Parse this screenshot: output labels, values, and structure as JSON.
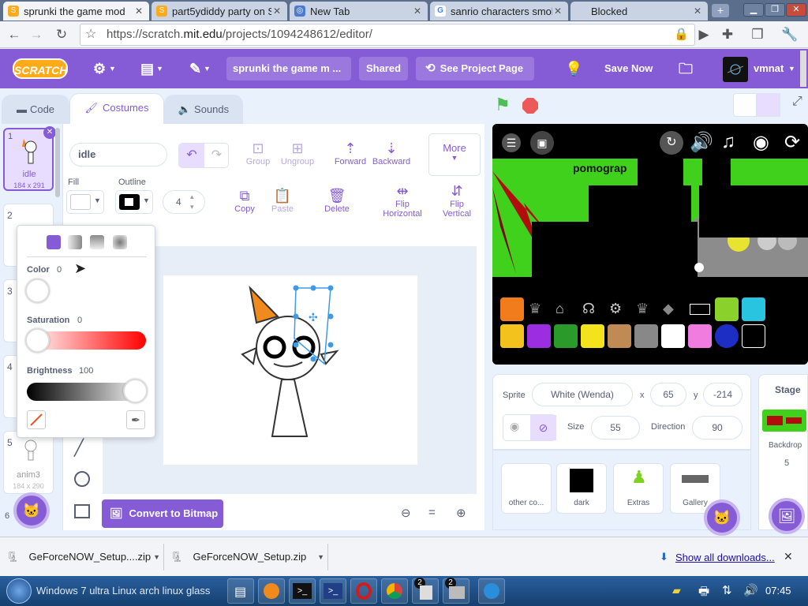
{
  "browser": {
    "tabs": [
      {
        "title": "sprunki the game mod",
        "active": true
      },
      {
        "title": "part5ydiddy party on Sc",
        "active": false
      },
      {
        "title": "New Tab",
        "active": false
      },
      {
        "title": "sanrio characters smol",
        "active": false
      },
      {
        "title": "Blocked",
        "active": false
      }
    ],
    "url_prefix": "https://scratch.",
    "url_domain": "mit.edu",
    "url_path": "/projects/1094248612/editor/"
  },
  "menubar": {
    "logo": "SCRATCH",
    "project_title": "sprunki the game m ...",
    "shared_label": "Shared",
    "see_project_label": "See Project Page",
    "save_now_label": "Save Now",
    "username": "vmnat"
  },
  "editor_tabs": {
    "code": "Code",
    "costumes": "Costumes",
    "sounds": "Sounds"
  },
  "costumes": [
    {
      "num": "1",
      "name": "idle",
      "size": "184 x 291",
      "selected": true
    },
    {
      "num": "2",
      "name": "",
      "size": "",
      "selected": false
    },
    {
      "num": "3",
      "name": "",
      "size": "",
      "selected": false
    },
    {
      "num": "4",
      "name": "",
      "size": "",
      "selected": false
    },
    {
      "num": "5",
      "name": "anim3",
      "size": "184 x 290",
      "selected": false
    },
    {
      "num": "6",
      "name": "",
      "size": "",
      "selected": false
    }
  ],
  "paint": {
    "costume_name": "idle",
    "group": "Group",
    "ungroup": "Ungroup",
    "forward": "Forward",
    "backward": "Backward",
    "more": "More",
    "fill_label": "Fill",
    "outline_label": "Outline",
    "outline_width": "4",
    "copy": "Copy",
    "paste": "Paste",
    "delete": "Delete",
    "flip_h_1": "Flip",
    "flip_h_2": "Horizontal",
    "flip_v_1": "Flip",
    "flip_v_2": "Vertical",
    "convert": "Convert to Bitmap"
  },
  "color_popup": {
    "color_label": "Color",
    "color_value": "0",
    "saturation_label": "Saturation",
    "saturation_value": "0",
    "brightness_label": "Brightness",
    "brightness_value": "100"
  },
  "stage": {
    "overlay_text": "pomograp"
  },
  "sprite_info": {
    "sprite_label": "Sprite",
    "sprite_name": "White (Wenda)",
    "x_label": "x",
    "x_value": "65",
    "y_label": "y",
    "y_value": "-214",
    "size_label": "Size",
    "size_value": "55",
    "direction_label": "Direction",
    "direction_value": "90"
  },
  "sprites": [
    {
      "name": "other co..."
    },
    {
      "name": "dark"
    },
    {
      "name": "Extras"
    },
    {
      "name": "Gallery"
    }
  ],
  "stage_panel": {
    "title": "Stage",
    "backdrops_label": "Backdrop",
    "backdrops_count": "5"
  },
  "downloads": [
    {
      "name": "GeForceNOW_Setup....zip"
    },
    {
      "name": "GeForceNOW_Setup.zip"
    }
  ],
  "show_all_downloads": "Show all downloads...",
  "taskbar": {
    "window_title": "Windows 7 ultra Linux arch linux glass",
    "clock": "07:45",
    "badge1": "2",
    "badge2": "2"
  },
  "colors": {
    "accent": "#855cd6",
    "brand_orange": "#ffab19",
    "stop_red": "#ec5959",
    "flag_green": "#4cbf56"
  }
}
